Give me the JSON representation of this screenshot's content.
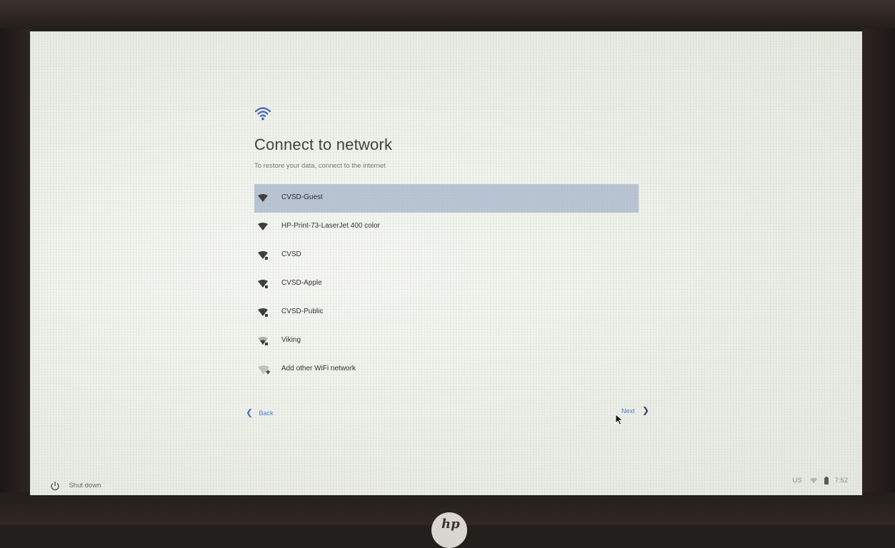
{
  "screen": {
    "title": "Connect to network",
    "subtitle": "To restore your data, connect to the internet"
  },
  "networks": [
    {
      "name": "CVSD-Guest",
      "secured": false,
      "selected": true
    },
    {
      "name": "HP-Print-73-LaserJet 400 color",
      "secured": false,
      "selected": false
    },
    {
      "name": "CVSD",
      "secured": true,
      "selected": false
    },
    {
      "name": "CVSD-Apple",
      "secured": true,
      "selected": false
    },
    {
      "name": "CVSD-Public",
      "secured": true,
      "selected": false
    },
    {
      "name": "Viking",
      "secured": true,
      "selected": false
    },
    {
      "name": "Add other WiFi network",
      "secured": false,
      "selected": false,
      "add": true
    }
  ],
  "nav": {
    "back_label": "Back",
    "next_label": "Next"
  },
  "shelf": {
    "shutdown_label": "Shut down",
    "ime_label": "US",
    "time": "7:52"
  },
  "icons": {
    "header": "wifi-icon",
    "network": "wifi-signal-icon",
    "secured": "lock-icon",
    "add": "add-network-icon",
    "shutdown": "power-icon",
    "battery": "battery-icon"
  },
  "colors": {
    "accent": "#4a7bd0",
    "selected_row": "#b9c4d4"
  }
}
